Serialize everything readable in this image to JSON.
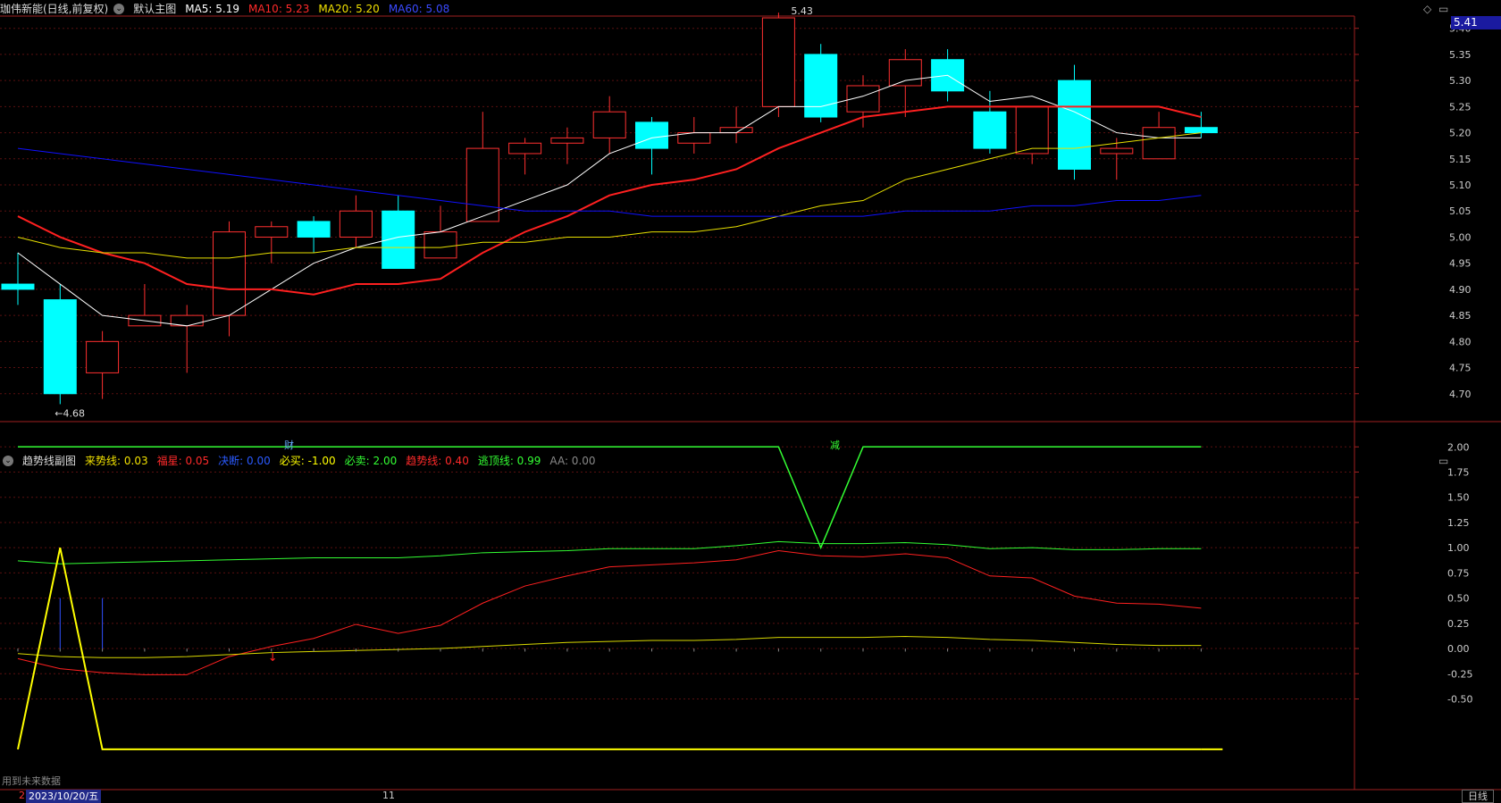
{
  "main_header": {
    "title": "珈伟新能(日线,前复权)",
    "template": "默认主图",
    "ma5": "MA5: 5.19",
    "ma10": "MA10: 5.23",
    "ma20": "MA20: 5.20",
    "ma60": "MA60: 5.08"
  },
  "sub_header": {
    "title": "趋势线副图",
    "items": [
      {
        "text": "来势线: 0.03",
        "color": "#f0e000"
      },
      {
        "text": "福星: 0.05",
        "color": "#ff2a2a"
      },
      {
        "text": "决断: 0.00",
        "color": "#2a5aff"
      },
      {
        "text": "必买: -1.00",
        "color": "#ffff00"
      },
      {
        "text": "必卖: 2.00",
        "color": "#33ff33"
      },
      {
        "text": "趋势线: 0.40",
        "color": "#ff2a2a"
      },
      {
        "text": "逃顶线: 0.99",
        "color": "#33ff33"
      },
      {
        "text": "AA: 0.00",
        "color": "#888888"
      }
    ]
  },
  "last_price": "5.41",
  "high_marker": "5.43",
  "low_marker": "4.68",
  "events": [
    "财",
    "减"
  ],
  "footer": {
    "note": "用到未来数据",
    "date": "2023/10/20/五",
    "month_marker": "11",
    "period_tab": "日线",
    "left_marker": "2"
  },
  "colors": {
    "up": "#ff3030",
    "down": "#00ffff",
    "ma5": "#ffffff",
    "ma10": "#ff2020",
    "ma20": "#e8e000",
    "ma60": "#1010ff"
  },
  "chart_data": [
    {
      "type": "candlestick",
      "ylim": [
        4.65,
        5.42
      ],
      "y_ticks": [
        "5.40",
        "5.35",
        "5.30",
        "5.25",
        "5.20",
        "5.15",
        "5.10",
        "5.05",
        "5.00",
        "4.95",
        "4.90",
        "4.85",
        "4.80",
        "4.75",
        "4.70"
      ],
      "candles": [
        {
          "o": 4.91,
          "c": 4.9,
          "h": 4.97,
          "l": 4.87
        },
        {
          "o": 4.88,
          "c": 4.7,
          "h": 4.91,
          "l": 4.68
        },
        {
          "o": 4.74,
          "c": 4.8,
          "h": 4.82,
          "l": 4.69
        },
        {
          "o": 4.83,
          "c": 4.85,
          "h": 4.91,
          "l": 4.83
        },
        {
          "o": 4.83,
          "c": 4.85,
          "h": 4.87,
          "l": 4.74
        },
        {
          "o": 4.85,
          "c": 5.01,
          "h": 5.03,
          "l": 4.81
        },
        {
          "o": 5.0,
          "c": 5.02,
          "h": 5.03,
          "l": 4.95
        },
        {
          "o": 5.03,
          "c": 5.0,
          "h": 5.04,
          "l": 4.97
        },
        {
          "o": 5.0,
          "c": 5.05,
          "h": 5.08,
          "l": 4.98
        },
        {
          "o": 5.05,
          "c": 4.94,
          "h": 5.08,
          "l": 4.94
        },
        {
          "o": 4.96,
          "c": 5.01,
          "h": 5.06,
          "l": 4.96
        },
        {
          "o": 5.03,
          "c": 5.17,
          "h": 5.24,
          "l": 5.03
        },
        {
          "o": 5.16,
          "c": 5.18,
          "h": 5.19,
          "l": 5.12
        },
        {
          "o": 5.18,
          "c": 5.19,
          "h": 5.21,
          "l": 5.14
        },
        {
          "o": 5.19,
          "c": 5.24,
          "h": 5.27,
          "l": 5.16
        },
        {
          "o": 5.22,
          "c": 5.17,
          "h": 5.23,
          "l": 5.12
        },
        {
          "o": 5.18,
          "c": 5.2,
          "h": 5.23,
          "l": 5.16
        },
        {
          "o": 5.2,
          "c": 5.21,
          "h": 5.25,
          "l": 5.18
        },
        {
          "o": 5.25,
          "c": 5.42,
          "h": 5.43,
          "l": 5.23
        },
        {
          "o": 5.35,
          "c": 5.23,
          "h": 5.37,
          "l": 5.22
        },
        {
          "o": 5.24,
          "c": 5.29,
          "h": 5.31,
          "l": 5.21
        },
        {
          "o": 5.29,
          "c": 5.34,
          "h": 5.36,
          "l": 5.23
        },
        {
          "o": 5.34,
          "c": 5.28,
          "h": 5.36,
          "l": 5.26
        },
        {
          "o": 5.24,
          "c": 5.17,
          "h": 5.28,
          "l": 5.16
        },
        {
          "o": 5.16,
          "c": 5.25,
          "h": 5.25,
          "l": 5.14
        },
        {
          "o": 5.3,
          "c": 5.13,
          "h": 5.33,
          "l": 5.11
        },
        {
          "o": 5.16,
          "c": 5.17,
          "h": 5.19,
          "l": 5.11
        },
        {
          "o": 5.15,
          "c": 5.21,
          "h": 5.24,
          "l": 5.15
        },
        {
          "o": 5.21,
          "c": 5.2,
          "h": 5.24,
          "l": 5.19
        }
      ],
      "series": [
        {
          "name": "MA5",
          "values": [
            4.97,
            4.91,
            4.85,
            4.84,
            4.83,
            4.85,
            4.9,
            4.95,
            4.98,
            5.0,
            5.01,
            5.04,
            5.07,
            5.1,
            5.16,
            5.19,
            5.2,
            5.2,
            5.25,
            5.25,
            5.27,
            5.3,
            5.31,
            5.26,
            5.27,
            5.24,
            5.2,
            5.19,
            5.19
          ]
        },
        {
          "name": "MA10",
          "values": [
            5.04,
            5.0,
            4.97,
            4.95,
            4.91,
            4.9,
            4.9,
            4.89,
            4.91,
            4.91,
            4.92,
            4.97,
            5.01,
            5.04,
            5.08,
            5.1,
            5.11,
            5.13,
            5.17,
            5.2,
            5.23,
            5.24,
            5.25,
            5.25,
            5.25,
            5.25,
            5.25,
            5.25,
            5.23
          ]
        },
        {
          "name": "MA20",
          "values": [
            5.0,
            4.98,
            4.97,
            4.97,
            4.96,
            4.96,
            4.97,
            4.97,
            4.98,
            4.98,
            4.98,
            4.99,
            4.99,
            5.0,
            5.0,
            5.01,
            5.01,
            5.02,
            5.04,
            5.06,
            5.07,
            5.11,
            5.13,
            5.15,
            5.17,
            5.17,
            5.18,
            5.19,
            5.2
          ]
        },
        {
          "name": "MA60",
          "values": [
            5.17,
            5.16,
            5.15,
            5.14,
            5.13,
            5.12,
            5.11,
            5.1,
            5.09,
            5.08,
            5.07,
            5.06,
            5.05,
            5.05,
            5.05,
            5.04,
            5.04,
            5.04,
            5.04,
            5.04,
            5.04,
            5.05,
            5.05,
            5.05,
            5.06,
            5.06,
            5.07,
            5.07,
            5.08
          ]
        }
      ]
    },
    {
      "type": "line",
      "ylim": [
        -0.85,
        2.1
      ],
      "y_ticks": [
        "2.00",
        "1.75",
        "1.50",
        "1.25",
        "1.00",
        "0.75",
        "0.50",
        "0.25",
        "0.00",
        "-0.25",
        "-0.50"
      ],
      "series": [
        {
          "name": "必卖",
          "values": [
            2,
            2,
            2,
            2,
            2,
            2,
            2,
            2,
            2,
            2,
            2,
            2,
            2,
            2,
            2,
            2,
            2,
            2,
            2,
            1.0,
            2,
            2,
            2,
            2,
            2,
            2,
            2,
            2,
            2
          ]
        },
        {
          "name": "逃顶线",
          "values": [
            0.87,
            0.84,
            0.85,
            0.86,
            0.87,
            0.88,
            0.89,
            0.9,
            0.9,
            0.9,
            0.92,
            0.95,
            0.96,
            0.97,
            0.99,
            0.99,
            0.99,
            1.02,
            1.06,
            1.04,
            1.04,
            1.05,
            1.03,
            0.99,
            1.0,
            0.98,
            0.98,
            0.99,
            0.99
          ]
        },
        {
          "name": "趋势线",
          "values": [
            -0.1,
            -0.2,
            -0.24,
            -0.26,
            -0.26,
            -0.08,
            0.02,
            0.1,
            0.24,
            0.15,
            0.23,
            0.45,
            0.62,
            0.72,
            0.81,
            0.83,
            0.85,
            0.88,
            0.97,
            0.92,
            0.91,
            0.94,
            0.9,
            0.72,
            0.7,
            0.52,
            0.45,
            0.44,
            0.4
          ]
        },
        {
          "name": "来势线",
          "values": [
            -0.05,
            -0.08,
            -0.09,
            -0.09,
            -0.08,
            -0.06,
            -0.04,
            -0.03,
            -0.02,
            -0.01,
            0.0,
            0.02,
            0.04,
            0.06,
            0.07,
            0.08,
            0.08,
            0.09,
            0.11,
            0.11,
            0.11,
            0.12,
            0.11,
            0.09,
            0.08,
            0.06,
            0.04,
            0.03,
            0.03
          ]
        },
        {
          "name": "必买",
          "values": [
            -1.0,
            1.0,
            -1.0,
            -1.0,
            -1.0,
            -1.0,
            -1.0,
            -1.0,
            -1.0,
            -1.0,
            -1.0,
            -1.0,
            -1.0,
            -1.0,
            -1.0,
            -1.0,
            -1.0,
            -1.0,
            -1.0,
            -1.0,
            -1.0,
            -1.0,
            -1.0,
            -1.0,
            -1.0,
            -1.0,
            -1.0,
            -1.0,
            -1.0
          ]
        }
      ]
    }
  ]
}
